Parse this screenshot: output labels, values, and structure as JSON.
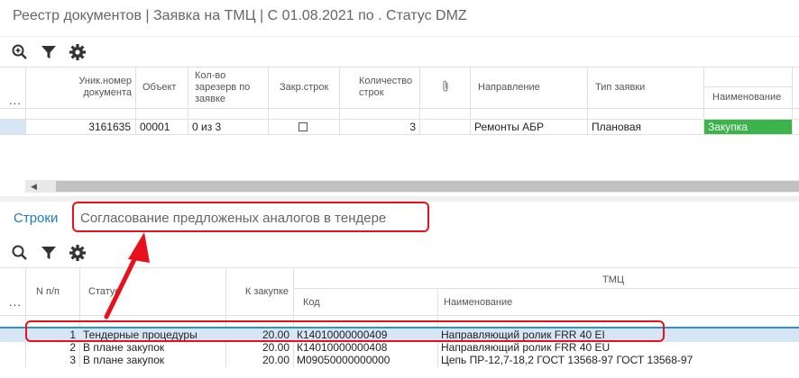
{
  "window": {
    "title": "Реестр документов | Заявка на ТМЦ | С 01.08.2021 по . Статус DMZ"
  },
  "top_toolbar": {
    "icons": [
      "zoom-icon",
      "filter-icon",
      "gear-icon"
    ]
  },
  "top_table": {
    "row_menu": "...",
    "headers": {
      "doc_number": "Уник.номер документа",
      "object": "Объект",
      "reserved": "Кол-во зарезерв по заявке",
      "closed_lines": "Закр.строк",
      "line_count": "Количество строк",
      "attachment_icon": "paperclip-icon",
      "direction": "Направление",
      "request_type": "Тип заявки",
      "name": "Наименование"
    },
    "rows": [
      {
        "doc_number": "3161635",
        "object": "00001",
        "reserved": "0 из 3",
        "closed_lines": "☐",
        "line_count": "3",
        "direction": "Ремонты АБР",
        "request_type": "Плановая",
        "name": "Закупка"
      }
    ]
  },
  "tabs": {
    "active": "Строки",
    "other": "Согласование предложеных аналогов в тендере"
  },
  "bottom_toolbar": {
    "icons": [
      "search-icon",
      "filter-icon",
      "gear-icon"
    ]
  },
  "bottom_table": {
    "row_menu": "...",
    "headers": {
      "num": "N п/п",
      "status": "Статус",
      "qty": "К закупке",
      "group": "ТМЦ",
      "code": "Код",
      "name": "Наименование"
    },
    "rows": [
      {
        "num": "1",
        "status": "Тендерные процедуры",
        "qty": "20.00",
        "code": "К14010000000409",
        "name": "Направляющий ролик FRR 40 EI"
      },
      {
        "num": "2",
        "status": "В плане закупок",
        "qty": "20.00",
        "code": "К14010000000408",
        "name": "Направляющий ролик FRR 40 EU"
      },
      {
        "num": "3",
        "status": "В плане закупок",
        "qty": "20.00",
        "code": "М09050000000000",
        "name": "Цепь ПР-12,7-18,2 ГОСТ 13568-97 ГОСТ 13568-97"
      }
    ]
  },
  "colors": {
    "accent": "#1f7bc1",
    "highlight_red": "#e8101a",
    "status_green": "#3cb44b",
    "selected_row": "#d6e6f5"
  }
}
